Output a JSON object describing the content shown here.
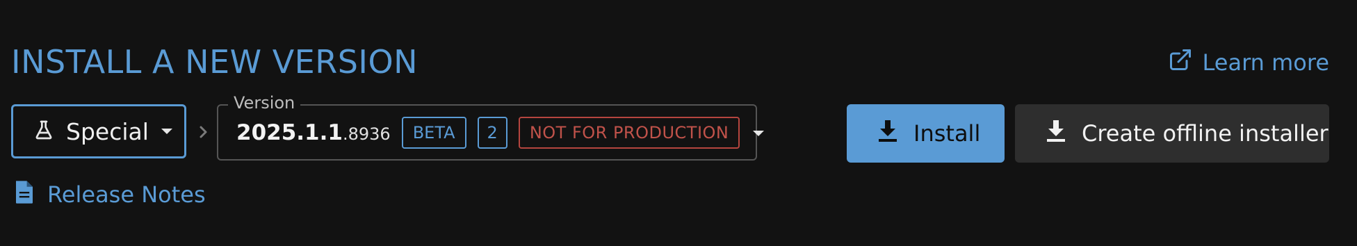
{
  "header": {
    "title": "INSTALL A NEW VERSION",
    "learn_more_label": "Learn more",
    "learn_more_icon": "external-link-icon"
  },
  "channel": {
    "selected": "Special",
    "icon": "flask-icon"
  },
  "version": {
    "legend": "Version",
    "main": "2025.1.1",
    "build": ".8936",
    "badges": {
      "beta": "BETA",
      "count": "2",
      "warning": "NOT FOR PRODUCTION"
    }
  },
  "actions": {
    "install_label": "Install",
    "offline_label": "Create offline installer",
    "icon": "download-icon"
  },
  "release_notes": {
    "label": "Release Notes",
    "icon": "document-icon"
  },
  "colors": {
    "background": "#121212",
    "accent": "#5a9bd5",
    "warning": "#c0524a",
    "secondary_button": "#2e2e2e"
  }
}
